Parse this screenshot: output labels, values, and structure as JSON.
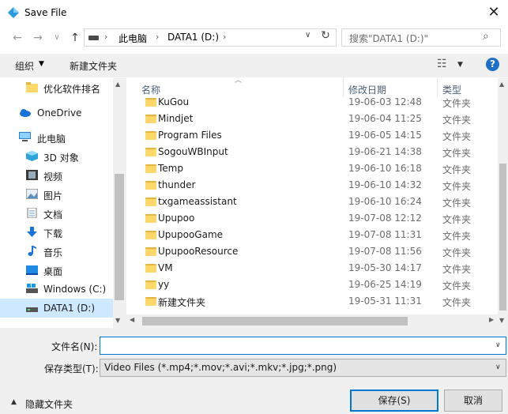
{
  "window": {
    "title": "Save File",
    "close_icon": "close-icon"
  },
  "nav": {
    "back": "←",
    "forward": "→",
    "dropdown": "∨",
    "up": "↑",
    "address": [
      "此电脑",
      "DATA1 (D:)"
    ],
    "refresh": "↻",
    "search_placeholder": "搜索\"DATA1 (D:)\""
  },
  "toolbar": {
    "organize": "组织",
    "new_folder": "新建文件夹"
  },
  "sidebar": {
    "items": [
      {
        "label": "优化软件排名",
        "icon": "folder-icon"
      },
      {
        "label": "OneDrive",
        "icon": "cloud-icon"
      },
      {
        "label": "此电脑",
        "icon": "computer-icon"
      },
      {
        "label": "3D 对象",
        "icon": "cube-icon"
      },
      {
        "label": "视频",
        "icon": "video-icon"
      },
      {
        "label": "图片",
        "icon": "picture-icon"
      },
      {
        "label": "文档",
        "icon": "document-icon"
      },
      {
        "label": "下载",
        "icon": "download-icon"
      },
      {
        "label": "音乐",
        "icon": "music-icon"
      },
      {
        "label": "桌面",
        "icon": "desktop-icon"
      },
      {
        "label": "Windows (C:)",
        "icon": "drive-icon"
      },
      {
        "label": "DATA1 (D:)",
        "icon": "drive-icon"
      }
    ]
  },
  "file_list": {
    "columns": {
      "name": "名称",
      "date": "修改日期",
      "type": "类型"
    },
    "rows": [
      {
        "name": "KuGou",
        "date": "19-06-03 12:48",
        "type": "文件夹"
      },
      {
        "name": "Mindjet",
        "date": "19-06-04 11:25",
        "type": "文件夹"
      },
      {
        "name": "Program Files",
        "date": "19-06-05 14:15",
        "type": "文件夹"
      },
      {
        "name": "SogouWBInput",
        "date": "19-06-21 14:38",
        "type": "文件夹"
      },
      {
        "name": "Temp",
        "date": "19-06-10 16:18",
        "type": "文件夹"
      },
      {
        "name": "thunder",
        "date": "19-06-10 14:32",
        "type": "文件夹"
      },
      {
        "name": "txgameassistant",
        "date": "19-06-10 16:24",
        "type": "文件夹"
      },
      {
        "name": "Upupoo",
        "date": "19-07-08 12:12",
        "type": "文件夹"
      },
      {
        "name": "UpupooGame",
        "date": "19-07-08 11:31",
        "type": "文件夹"
      },
      {
        "name": "UpupooResource",
        "date": "19-07-08 11:56",
        "type": "文件夹"
      },
      {
        "name": "VM",
        "date": "19-05-30 14:17",
        "type": "文件夹"
      },
      {
        "name": "yy",
        "date": "19-06-25 14:19",
        "type": "文件夹"
      },
      {
        "name": "新建文件夹",
        "date": "19-05-31 11:31",
        "type": "文件夹"
      }
    ]
  },
  "form": {
    "filename_label": "文件名(N):",
    "filename_value": "",
    "filetype_label": "保存类型(T):",
    "filetype_value": "Video Files (*.mp4;*.mov;*.avi;*.mkv;*.jpg;*.png)"
  },
  "footer": {
    "hide_folders": "隐藏文件夹",
    "save": "保存(S)",
    "cancel": "取消"
  },
  "colors": {
    "accent": "#0078d7",
    "selected": "#cde8ff",
    "folder": "#ffd86b"
  }
}
